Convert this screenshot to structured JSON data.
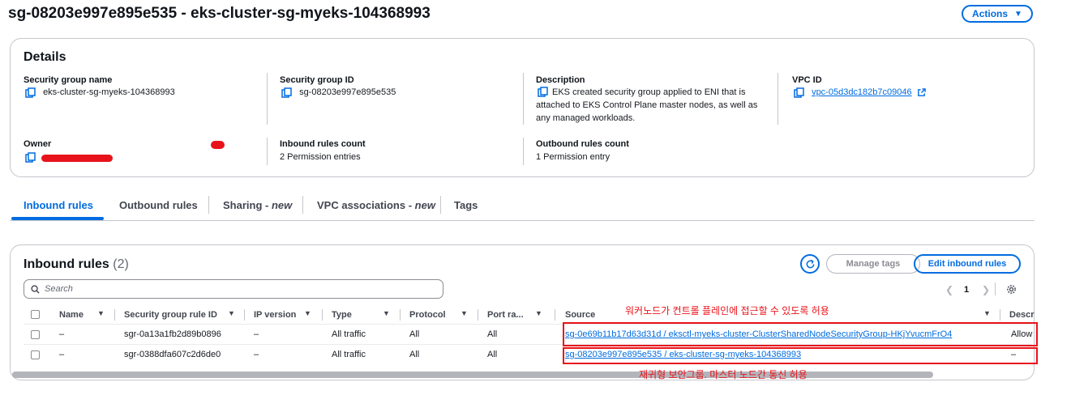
{
  "header": {
    "title": "sg-08203e997e895e535 - eks-cluster-sg-myeks-104368993",
    "actions_label": "Actions"
  },
  "details": {
    "title": "Details",
    "sg_name_label": "Security group name",
    "sg_name": "eks-cluster-sg-myeks-104368993",
    "sg_id_label": "Security group ID",
    "sg_id": "sg-08203e997e895e535",
    "description_label": "Description",
    "description": "EKS created security group applied to ENI that is attached to EKS Control Plane master nodes, as well as any managed workloads.",
    "vpc_label": "VPC ID",
    "vpc_id": "vpc-05d3dc182b7c09046",
    "owner_label": "Owner",
    "inbound_count_label": "Inbound rules count",
    "inbound_count": "2 Permission entries",
    "outbound_count_label": "Outbound rules count",
    "outbound_count": "1 Permission entry"
  },
  "tabs": [
    {
      "label": "Inbound rules",
      "suffix": ""
    },
    {
      "label": "Outbound rules",
      "suffix": ""
    },
    {
      "label": "Sharing - ",
      "suffix": "new"
    },
    {
      "label": "VPC associations - ",
      "suffix": "new"
    },
    {
      "label": "Tags",
      "suffix": ""
    }
  ],
  "rules": {
    "title": "Inbound rules",
    "count": "(2)",
    "manage_tags": "Manage tags",
    "edit_rules": "Edit inbound rules",
    "search_placeholder": "Search",
    "page": "1",
    "columns": [
      "Name",
      "Security group rule ID",
      "IP version",
      "Type",
      "Protocol",
      "Port ra...",
      "Source",
      "Descr"
    ],
    "rows": [
      {
        "name": "–",
        "rule_id": "sgr-0a13a1fb2d89b0896",
        "ip_version": "–",
        "type": "All traffic",
        "protocol": "All",
        "port": "All",
        "source": "sg-0e69b11b17d63d31d / eksctl-myeks-cluster-ClusterSharedNodeSecurityGroup-HKjYvucmFrO4",
        "description": "Allow"
      },
      {
        "name": "–",
        "rule_id": "sgr-0388dfa607c2d6de0",
        "ip_version": "–",
        "type": "All traffic",
        "protocol": "All",
        "port": "All",
        "source": "sg-08203e997e895e535 / eks-cluster-sg-myeks-104368993",
        "description": "–"
      }
    ]
  },
  "annotations": {
    "top": "워커노드가 컨트롤 플레인에 접근할 수 있도록 허용",
    "bottom": "재귀형 보안그룹. 마스터 노드간 통신 허용"
  },
  "colors": {
    "accent": "#006ce0",
    "annotation": "#e8131a"
  }
}
